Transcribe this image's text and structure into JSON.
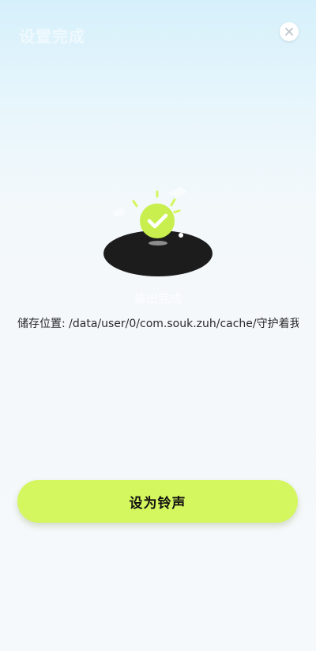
{
  "header": {
    "title": "设置完成"
  },
  "result": {
    "status_text": "输出完成",
    "storage_path": "储存位置: /data/user/0/com.souk.zuh/cache/守护着我…"
  },
  "actions": {
    "set_ringtone_label": "设为铃声"
  },
  "colors": {
    "accent": "#d4f65e",
    "check_badge": "#c8ef4e",
    "disc": "#1c1c1c"
  },
  "icons": {
    "close": "close-icon",
    "success": "check-circle-icon"
  }
}
